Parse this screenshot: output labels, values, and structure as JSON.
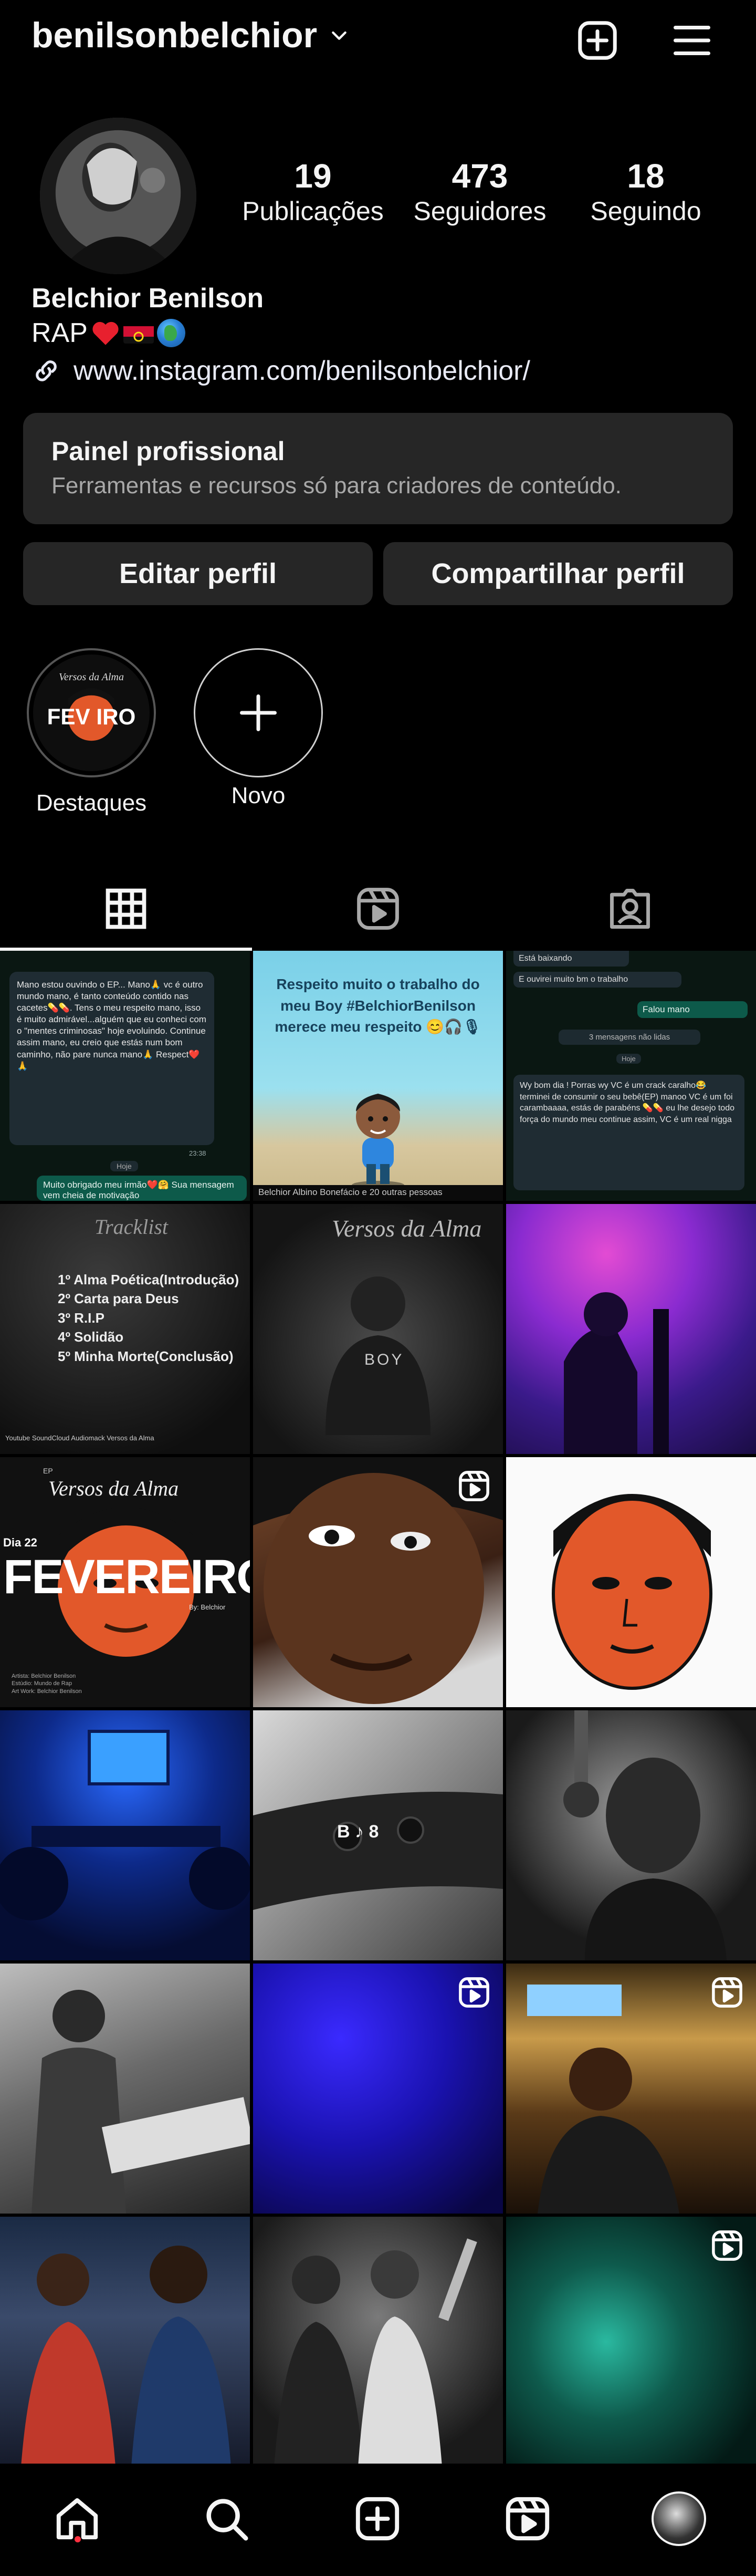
{
  "header": {
    "username": "benilsonbelchior"
  },
  "profile": {
    "stats": [
      {
        "value": "19",
        "label": "Publicações"
      },
      {
        "value": "473",
        "label": "Seguidores"
      },
      {
        "value": "18",
        "label": "Seguindo"
      }
    ],
    "name": "Belchior Benilson",
    "bio": "RAP",
    "link": "www.instagram.com/benilsonbelchior/"
  },
  "professional_panel": {
    "title": "Painel profissional",
    "subtitle": "Ferramentas e recursos só para criadores de conteúdo."
  },
  "buttons": {
    "edit": "Editar perfil",
    "share": "Compartilhar perfil"
  },
  "highlights": [
    {
      "label": "Destaques"
    },
    {
      "label": "Novo"
    }
  ],
  "grid_text": {
    "p1_msg": "Mano estou ouvindo o EP... Mano🙏 vc é outro mundo mano, é tanto conteúdo contido nas cacetes💊💊. Tens o meu respeito mano, isso é muito admirável...alguém que eu conheci com o \"mentes criminosas\" hoje evoluindo. Continue assim mano, eu creio que estás num bom caminho, não pare nunca mano🙏 Respect❤️🙏",
    "p1_time": "23:38",
    "p1_today": "Hoje",
    "p1_reply": "Muito obrigado meu irmão❤️🤗 Sua mensagem vem cheia de motivação",
    "p2_text": "Respeito muito o trabalho do meu Boy #BelchiorBenilson merece meu respeito 😊🎧🎙",
    "p2_footer": "Belchior Albino Bonefácio e 20 outras pessoas",
    "p3_a": "Está baixando",
    "p3_b": "E ouvirei muito bm o trabalho",
    "p3_c": "Falou mano",
    "p3_d": "3 mensagens não lidas",
    "p3_e": "Hoje",
    "p3_f": "Wy bom dia ! Porras wy VC é um crack caralho😂 terminei de consumir o seu bebê(EP) manoo VC é um foi carambaaaa, estás de parabéns 💊💊 eu lhe desejo todo força do mundo meu continue assim, VC é um real nigga",
    "p4_title": "Tracklist",
    "p4_tracks": [
      "1º Alma Poética(Introdução)",
      "2º Carta para Deus",
      "3º R.I.P",
      "4º Solidão",
      "5º Minha Morte(Conclusão)"
    ],
    "p4_footer": "Youtube   SoundCloud   Audiomack   Versos da Alma",
    "p5_title": "Versos da Alma",
    "p5_boy": "BOY",
    "p7_ep": "EP",
    "p7_title": "Versos da Alma",
    "p7_dia": "Dia 22",
    "p7_month": "FEVEREIRO",
    "p7_by": "By: Belchior",
    "p7_credits": "Artista: Belchior Benilson\nEstúdio: Mundo de Rap\nArt Work: Belchior Benilson",
    "p11_beads": "B  ♪  8"
  },
  "icons": {
    "top_right": [
      "plus-square-icon",
      "hamburger-menu-icon"
    ],
    "tabs": [
      "grid-icon",
      "reels-icon",
      "tagged-icon"
    ],
    "nav": [
      "home-icon",
      "search-icon",
      "create-icon",
      "reels-icon",
      "profile-avatar"
    ]
  },
  "colors": {
    "background": "#000000",
    "surface": "#262626",
    "text": "#f5f5f5",
    "muted": "#a8a8a8",
    "notification_dot": "#ff3040",
    "whatsapp_green": "#005c4b"
  }
}
